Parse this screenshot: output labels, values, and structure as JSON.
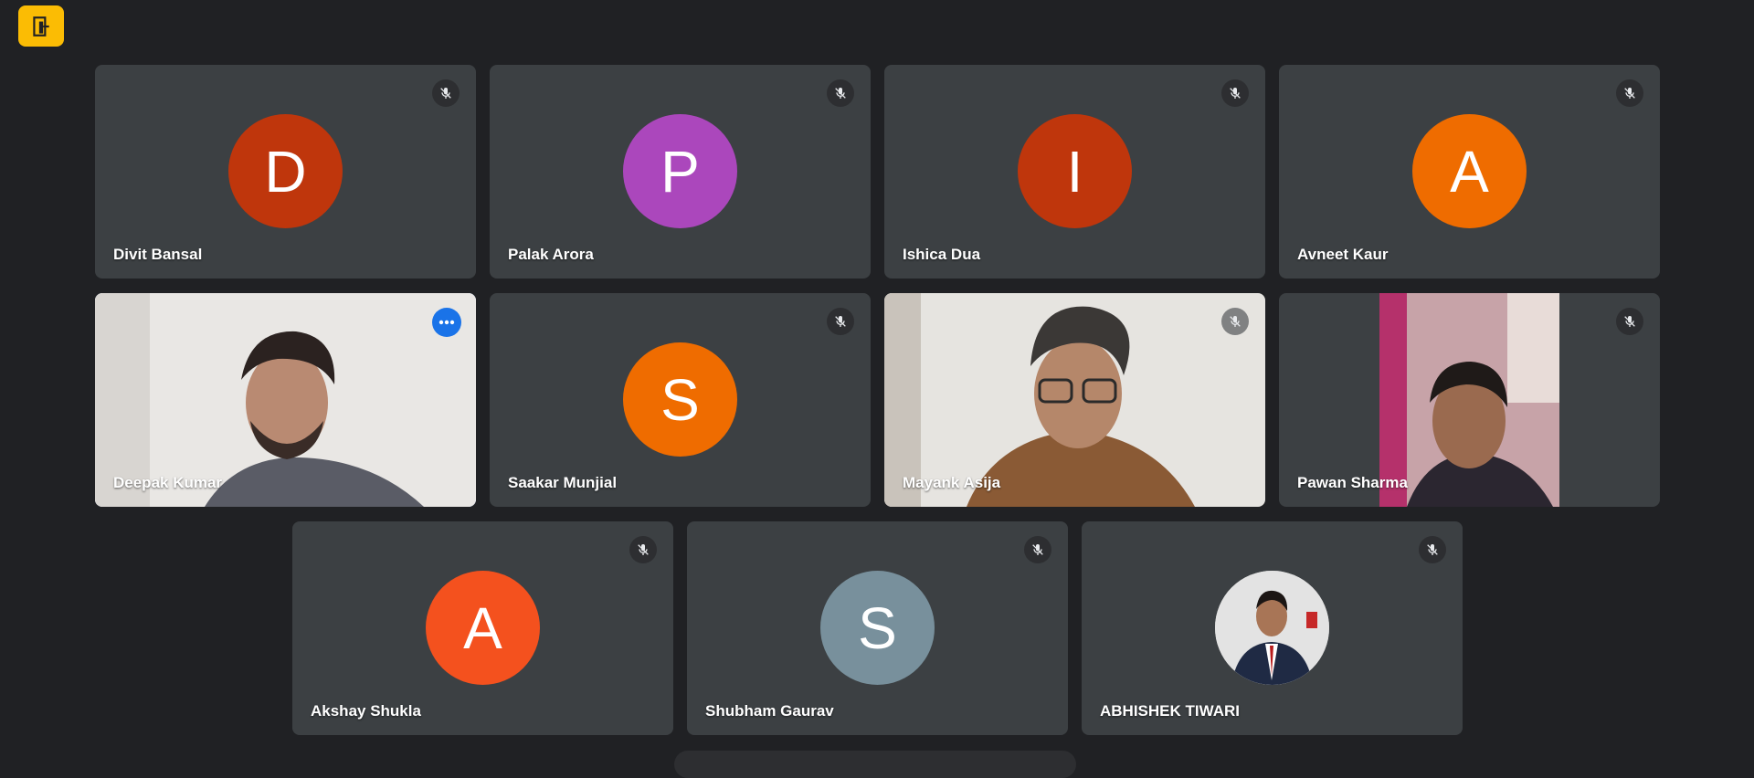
{
  "participants": [
    {
      "name": "Divit Bansal",
      "initial": "D",
      "avatar_color": "#bf360c",
      "muted": true
    },
    {
      "name": "Palak Arora",
      "initial": "P",
      "avatar_color": "#ab47bc",
      "muted": true
    },
    {
      "name": "Ishica Dua",
      "initial": "I",
      "avatar_color": "#bf360c",
      "muted": true
    },
    {
      "name": "Avneet Kaur",
      "initial": "A",
      "avatar_color": "#ef6c00",
      "muted": true
    },
    {
      "name": "Deepak Kumar",
      "video": true,
      "active_speaker": true
    },
    {
      "name": "Saakar Munjial",
      "initial": "S",
      "avatar_color": "#ef6c00",
      "muted": true
    },
    {
      "name": "Mayank Asija",
      "video": true,
      "muted": true
    },
    {
      "name": "Pawan Sharma",
      "video": true,
      "muted": true
    },
    {
      "name": "Akshay Shukla",
      "initial": "A",
      "avatar_color": "#f4511e",
      "muted": true
    },
    {
      "name": "Shubham Gaurav",
      "initial": "S",
      "avatar_color": "#78909c",
      "muted": true
    },
    {
      "name": "ABHISHEK TIWARI",
      "photo_avatar": true,
      "muted": true
    }
  ],
  "colors": {
    "background": "#202124",
    "tile": "#3c4043",
    "accent": "#8ab4f8",
    "badge": "#fbbc04"
  },
  "icons": {
    "app_badge": "exit-door-icon",
    "muted": "mic-off-icon",
    "more": "more-options-icon"
  }
}
